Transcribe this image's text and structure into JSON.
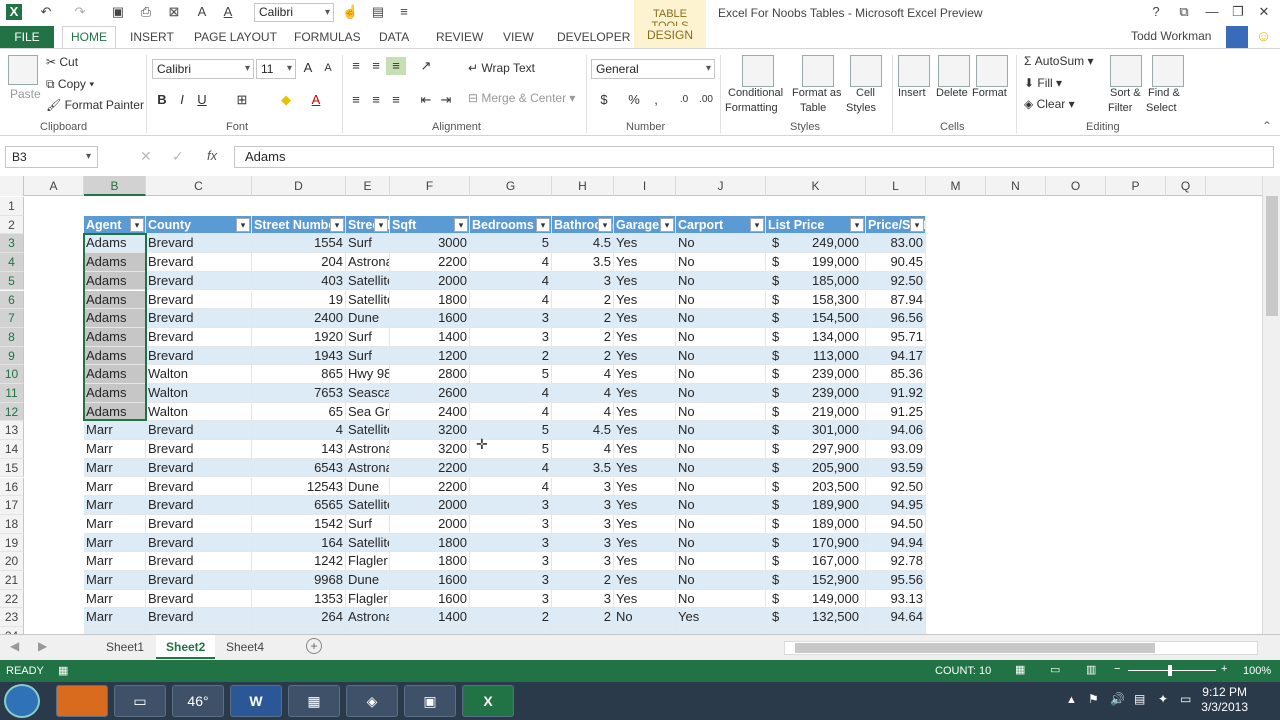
{
  "window_title": "Excel For Noobs Tables - Microsoft Excel Preview",
  "table_tools_label": "TABLE TOOLS",
  "user_name": "Todd Workman",
  "qat_font": "Calibri",
  "tabs": [
    "FILE",
    "HOME",
    "INSERT",
    "PAGE LAYOUT",
    "FORMULAS",
    "DATA",
    "REVIEW",
    "VIEW",
    "DEVELOPER",
    "DESIGN"
  ],
  "ribbon": {
    "clipboard": {
      "paste": "Paste",
      "cut": "Cut",
      "copy": "Copy",
      "format_painter": "Format Painter",
      "label": "Clipboard"
    },
    "font": {
      "name": "Calibri",
      "size": "11",
      "label": "Font"
    },
    "alignment": {
      "wrap_text": "Wrap Text",
      "merge_center": "Merge & Center",
      "label": "Alignment"
    },
    "number": {
      "format": "General",
      "label": "Number"
    },
    "styles": {
      "conditional": "Conditional",
      "conditional2": "Formatting",
      "format_as": "Format as",
      "format_as2": "Table",
      "cell": "Cell",
      "cell2": "Styles",
      "label": "Styles"
    },
    "cells": {
      "insert": "Insert",
      "delete": "Delete",
      "format": "Format",
      "label": "Cells"
    },
    "editing": {
      "autosum": "AutoSum",
      "fill": "Fill",
      "clear": "Clear",
      "sort": "Sort &",
      "sort2": "Filter",
      "find": "Find &",
      "find2": "Select",
      "label": "Editing"
    }
  },
  "namebox": "B3",
  "formula": "Adams",
  "columns": [
    "A",
    "B",
    "C",
    "D",
    "E",
    "F",
    "G",
    "H",
    "I",
    "J",
    "K",
    "L",
    "M",
    "N",
    "O",
    "P",
    "Q"
  ],
  "rows": [
    "1",
    "2",
    "3",
    "4",
    "5",
    "6",
    "7",
    "8",
    "9",
    "10",
    "11",
    "12",
    "13",
    "14",
    "15",
    "16",
    "17",
    "18",
    "19",
    "20",
    "21",
    "22",
    "23",
    "24"
  ],
  "table_headers": [
    "Agent",
    "County",
    "Street Number",
    "Street Name",
    "Sqft",
    "Bedrooms",
    "Bathrooms",
    "Garage",
    "Carport",
    "List Price",
    "Price/Sqft"
  ],
  "table_rows": [
    [
      "Adams",
      "Brevard",
      "1554",
      "Surf",
      "3000",
      "5",
      "4.5",
      "Yes",
      "No",
      "$",
      "249,000",
      "83.00"
    ],
    [
      "Adams",
      "Brevard",
      "204",
      "Astronaut",
      "2200",
      "4",
      "3.5",
      "Yes",
      "No",
      "$",
      "199,000",
      "90.45"
    ],
    [
      "Adams",
      "Brevard",
      "403",
      "Satellite",
      "2000",
      "4",
      "3",
      "Yes",
      "No",
      "$",
      "185,000",
      "92.50"
    ],
    [
      "Adams",
      "Brevard",
      "19",
      "Satellite",
      "1800",
      "4",
      "2",
      "Yes",
      "No",
      "$",
      "158,300",
      "87.94"
    ],
    [
      "Adams",
      "Brevard",
      "2400",
      "Dune",
      "1600",
      "3",
      "2",
      "Yes",
      "No",
      "$",
      "154,500",
      "96.56"
    ],
    [
      "Adams",
      "Brevard",
      "1920",
      "Surf",
      "1400",
      "3",
      "2",
      "Yes",
      "No",
      "$",
      "134,000",
      "95.71"
    ],
    [
      "Adams",
      "Brevard",
      "1943",
      "Surf",
      "1200",
      "2",
      "2",
      "Yes",
      "No",
      "$",
      "113,000",
      "94.17"
    ],
    [
      "Adams",
      "Walton",
      "865",
      "Hwy 98",
      "2800",
      "5",
      "4",
      "Yes",
      "No",
      "$",
      "239,000",
      "85.36"
    ],
    [
      "Adams",
      "Walton",
      "7653",
      "Seascape",
      "2600",
      "4",
      "4",
      "Yes",
      "No",
      "$",
      "239,000",
      "91.92"
    ],
    [
      "Adams",
      "Walton",
      "65",
      "Sea Grape",
      "2400",
      "4",
      "4",
      "Yes",
      "No",
      "$",
      "219,000",
      "91.25"
    ],
    [
      "Marr",
      "Brevard",
      "4",
      "Satellite",
      "3200",
      "5",
      "4.5",
      "Yes",
      "No",
      "$",
      "301,000",
      "94.06"
    ],
    [
      "Marr",
      "Brevard",
      "143",
      "Astronaut",
      "3200",
      "5",
      "4",
      "Yes",
      "No",
      "$",
      "297,900",
      "93.09"
    ],
    [
      "Marr",
      "Brevard",
      "6543",
      "Astronaut",
      "2200",
      "4",
      "3.5",
      "Yes",
      "No",
      "$",
      "205,900",
      "93.59"
    ],
    [
      "Marr",
      "Brevard",
      "12543",
      "Dune",
      "2200",
      "4",
      "3",
      "Yes",
      "No",
      "$",
      "203,500",
      "92.50"
    ],
    [
      "Marr",
      "Brevard",
      "6565",
      "Satellite",
      "2000",
      "3",
      "3",
      "Yes",
      "No",
      "$",
      "189,900",
      "94.95"
    ],
    [
      "Marr",
      "Brevard",
      "1542",
      "Surf",
      "2000",
      "3",
      "3",
      "Yes",
      "No",
      "$",
      "189,000",
      "94.50"
    ],
    [
      "Marr",
      "Brevard",
      "164",
      "Satellite",
      "1800",
      "3",
      "3",
      "Yes",
      "No",
      "$",
      "170,900",
      "94.94"
    ],
    [
      "Marr",
      "Brevard",
      "1242",
      "Flagler",
      "1800",
      "3",
      "3",
      "Yes",
      "No",
      "$",
      "167,000",
      "92.78"
    ],
    [
      "Marr",
      "Brevard",
      "9968",
      "Dune",
      "1600",
      "3",
      "2",
      "Yes",
      "No",
      "$",
      "152,900",
      "95.56"
    ],
    [
      "Marr",
      "Brevard",
      "1353",
      "Flagler",
      "1600",
      "3",
      "3",
      "Yes",
      "No",
      "$",
      "149,000",
      "93.13"
    ],
    [
      "Marr",
      "Brevard",
      "264",
      "Astronaut",
      "1400",
      "2",
      "2",
      "No",
      "Yes",
      "$",
      "132,500",
      "94.64"
    ]
  ],
  "sheets": [
    "Sheet1",
    "Sheet2",
    "Sheet4"
  ],
  "active_sheet": "Sheet2",
  "status": {
    "ready": "READY",
    "count": "COUNT: 10",
    "zoom": "100%"
  },
  "taskbar": {
    "weather": "46°",
    "time": "9:12 PM",
    "date": "3/3/2013"
  },
  "colors": {
    "excel_green": "#217346",
    "table_header": "#5b9bd5",
    "band": "#ddebf7"
  }
}
